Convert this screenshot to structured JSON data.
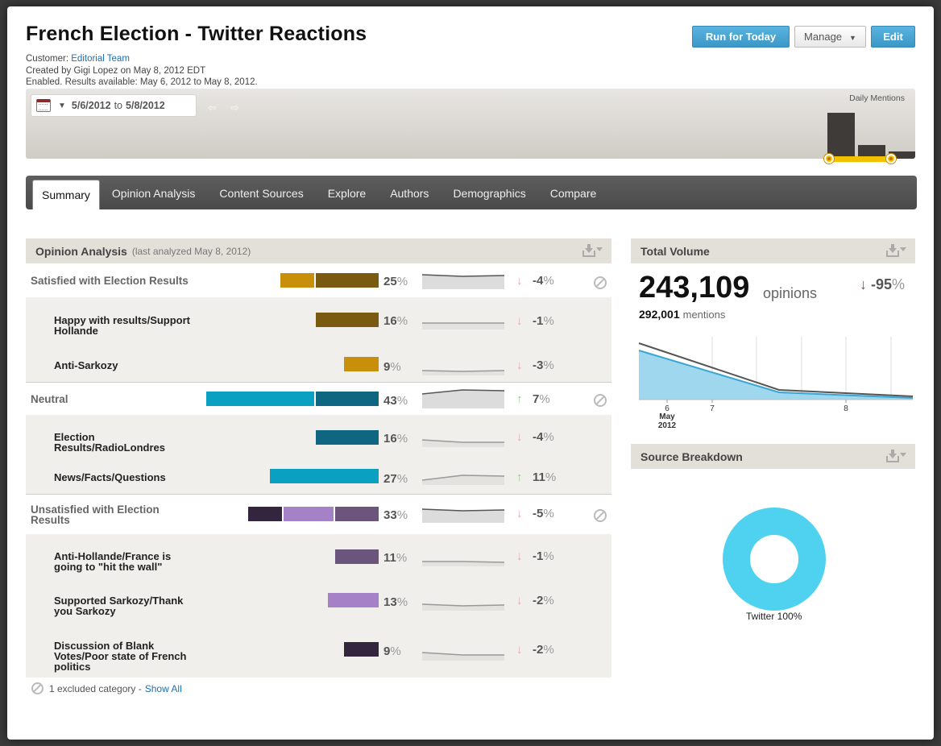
{
  "header": {
    "title": "French Election - Twitter Reactions",
    "customer_label": "Customer:",
    "customer": "Editorial Team",
    "created": "Created by Gigi Lopez on May 8, 2012 EDT",
    "status": "Enabled. Results available: May 6, 2012 to May 8, 2012.",
    "run_label": "Run for Today",
    "manage_label": "Manage",
    "edit_label": "Edit"
  },
  "daterange": {
    "start": "5/6/2012",
    "to": "to",
    "end": "5/8/2012",
    "daily_mentions_label": "Daily Mentions",
    "daily_mentions_relative": [
      1.0,
      0.3,
      0.15
    ]
  },
  "tabs": [
    "Summary",
    "Opinion Analysis",
    "Content Sources",
    "Explore",
    "Authors",
    "Demographics",
    "Compare"
  ],
  "opinion": {
    "title": "Opinion Analysis",
    "subtitle": "(last analyzed May 8, 2012)",
    "rows": [
      {
        "label": "Satisfied with Election Results",
        "pct": "25",
        "trend": "-4",
        "dir": "down",
        "level": "top"
      },
      {
        "label": "Happy with results/Support Hollande",
        "pct": "16",
        "trend": "-1",
        "dir": "down",
        "level": "child"
      },
      {
        "label": "Anti-Sarkozy",
        "pct": "9",
        "trend": "-3",
        "dir": "down",
        "level": "child"
      },
      {
        "label": "Neutral",
        "pct": "43",
        "trend": "7",
        "dir": "up",
        "level": "top"
      },
      {
        "label": "Election Results/RadioLondres",
        "pct": "16",
        "trend": "-4",
        "dir": "down",
        "level": "child"
      },
      {
        "label": "News/Facts/Questions",
        "pct": "27",
        "trend": "11",
        "dir": "up",
        "level": "child"
      },
      {
        "label": "Unsatisfied with Election Results",
        "pct": "33",
        "trend": "-5",
        "dir": "down",
        "level": "top"
      },
      {
        "label": "Anti-Hollande/France is going to \"hit the wall\"",
        "pct": "11",
        "trend": "-1",
        "dir": "down",
        "level": "child"
      },
      {
        "label": "Supported Sarkozy/Thank you Sarkozy",
        "pct": "13",
        "trend": "-2",
        "dir": "down",
        "level": "child"
      },
      {
        "label": "Discussion of Blank Votes/Poor state of French politics",
        "pct": "9",
        "trend": "-2",
        "dir": "down",
        "level": "child"
      }
    ],
    "percent_sign": "%",
    "excluded_text": "1 excluded category -",
    "show_all": "Show All"
  },
  "volume": {
    "title": "Total Volume",
    "opinions": "243,109",
    "opinions_label": "opinions",
    "delta": "-95",
    "mentions": "292,001",
    "mentions_label": "mentions",
    "x_ticks": [
      "6",
      "7",
      "8"
    ],
    "x_month": "May",
    "x_year": "2012"
  },
  "sources": {
    "title": "Source Breakdown",
    "label": "Twitter 100%",
    "color": "#4fd2f0"
  },
  "colors": {
    "gold": "#c8900a",
    "brown": "#7a5a10",
    "cyan": "#0aa0c2",
    "teal": "#0f6680",
    "plum": "#33253d",
    "lilac": "#a581c8",
    "mauve": "#6b557d",
    "accent_blue": "#3b97c7"
  }
}
